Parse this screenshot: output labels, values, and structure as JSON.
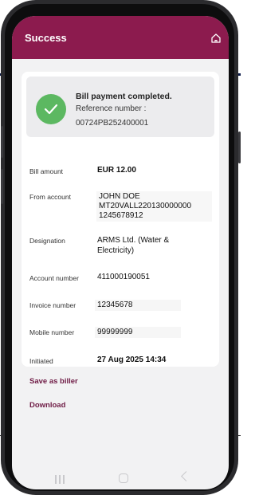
{
  "colors": {
    "brand": "#8c1b4e",
    "success": "#5cb861",
    "link": "#6e1a44"
  },
  "header": {
    "title": "Success",
    "home_icon": "home-icon"
  },
  "status": {
    "message": "Bill payment completed.",
    "reference_label": "Reference number :",
    "reference_value": "00724PB252400001",
    "icon": "check-icon"
  },
  "details": {
    "bill_amount": {
      "label": "Bill amount",
      "value": "EUR 12.00"
    },
    "from_account": {
      "label": "From account",
      "lines": [
        "JOHN DOE",
        "MT20VALL220130000000",
        "1245678912"
      ]
    },
    "designation": {
      "label": "Designation",
      "lines": [
        "ARMS Ltd. (Water &",
        "Electricity)"
      ]
    },
    "account_number": {
      "label": "Account number",
      "value": "411000190051"
    },
    "invoice_number": {
      "label": "Invoice number",
      "value": "12345678"
    },
    "mobile_number": {
      "label": "Mobile number",
      "value": "99999999"
    },
    "initiated": {
      "label": "Initiated",
      "value": "27 Aug 2025 14:34"
    }
  },
  "actions": {
    "save_as_biller": "Save as biller",
    "download": "Download"
  },
  "system_nav": {
    "recent_icon": "recent-apps-icon",
    "home_icon": "nav-home-icon",
    "back_icon": "back-icon"
  }
}
